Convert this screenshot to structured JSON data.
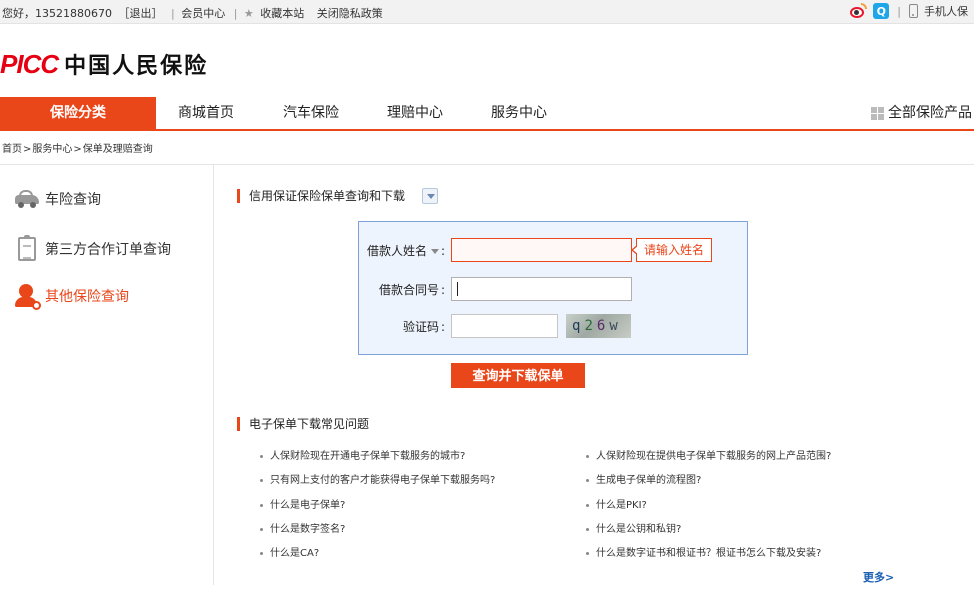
{
  "topbar": {
    "greeting": "您好，13521880670",
    "logout": "［退出］",
    "member_center": "会员中心",
    "bookmark": "收藏本站",
    "privacy": "关闭隐私政策",
    "mobile": "手机人保",
    "sep": "|",
    "qq_letter": "Q"
  },
  "logo": {
    "brand": "PICC",
    "name": "中国人民保险"
  },
  "nav": {
    "items": [
      "保险分类",
      "商城首页",
      "汽车保险",
      "理赔中心",
      "服务中心"
    ],
    "all_products": "全部保险产品"
  },
  "breadcrumb": [
    "首页",
    ">",
    "服务中心",
    ">",
    "保单及理赔查询"
  ],
  "sidebar": {
    "items": [
      {
        "label": "车险查询"
      },
      {
        "label": "第三方合作订单查询"
      },
      {
        "label": "其他保险查询"
      }
    ]
  },
  "main": {
    "section_title": "信用保证保险保单查询和下载",
    "form": {
      "borrower_label": "借款人姓名",
      "borrower_value": "",
      "borrower_error": "请输入姓名",
      "contract_label": "借款合同号",
      "contract_value": "",
      "captcha_label": "验证码",
      "captcha_value": "",
      "captcha_chars": [
        "q",
        "2",
        "6",
        "w"
      ],
      "colon": ":",
      "submit": "查询并下载保单"
    },
    "faq_title": "电子保单下载常见问题",
    "faq": [
      "人保财险现在开通电子保单下载服务的城市?",
      "人保财险现在提供电子保单下载服务的网上产品范围?",
      "只有网上支付的客户才能获得电子保单下载服务吗?",
      "生成电子保单的流程图?",
      "什么是电子保单?",
      "什么是PKI?",
      "什么是数字签名?",
      "什么是公钥和私钥?",
      "什么是CA?",
      "什么是数字证书和根证书？根证书怎么下载及安装?"
    ],
    "more": "更多>"
  }
}
